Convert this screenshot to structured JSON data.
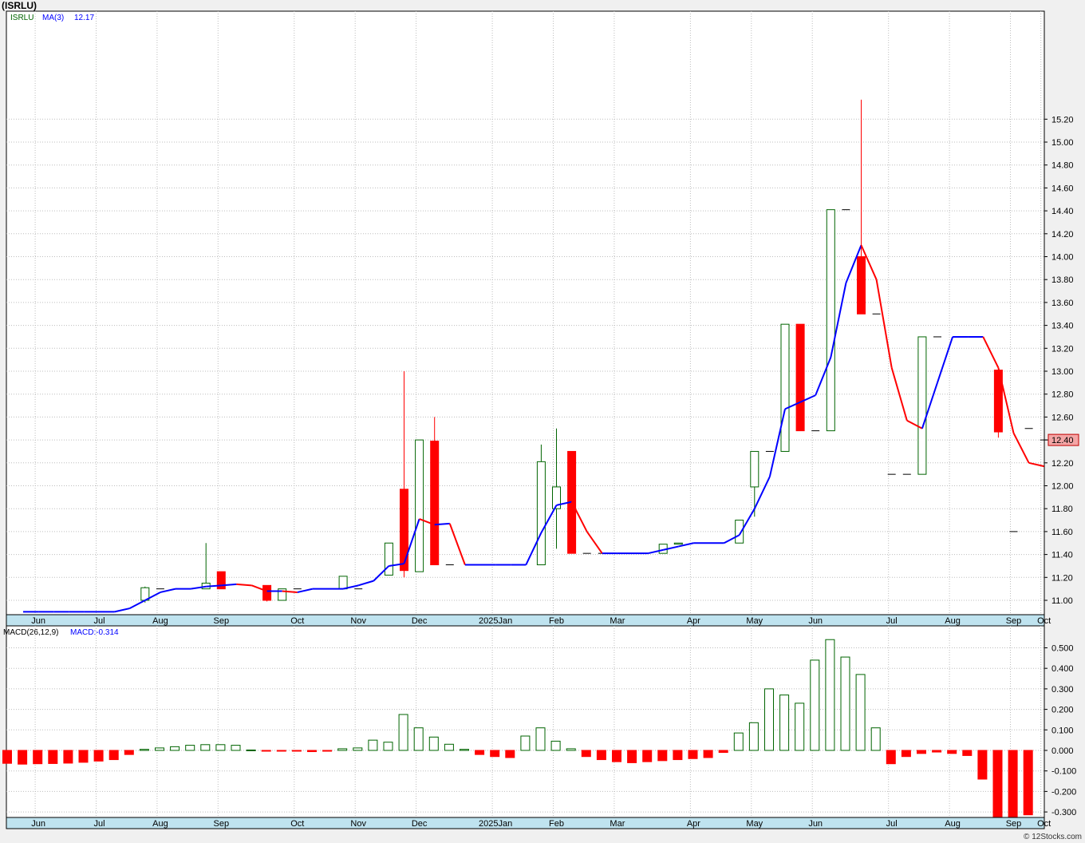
{
  "title": "(ISRLU)",
  "credit": "© 12Stocks.com",
  "colors": {
    "up": "#006400",
    "down": "#ff0000",
    "ma_up": "#0000ff",
    "ma_down": "#ff0000",
    "axis_bar": "#bfe3ef",
    "grid": "#bdbdbd"
  },
  "chart_data": [
    {
      "type": "candlestick",
      "legend": [
        {
          "text": "ISRLU",
          "color": "#006400"
        },
        {
          "text": "MA(3)",
          "color": "#0000ff"
        },
        {
          "text": "12.17",
          "color": "#0000ff"
        }
      ],
      "last_price": "12.40",
      "ylim": [
        10.87,
        15.49
      ],
      "yticks": [
        "11.00",
        "11.20",
        "11.40",
        "11.60",
        "11.80",
        "12.00",
        "12.20",
        "12.40",
        "12.60",
        "12.80",
        "13.00",
        "13.20",
        "13.40",
        "13.60",
        "13.80",
        "14.00",
        "14.20",
        "14.40",
        "14.60",
        "14.80",
        "15.00",
        "15.20"
      ],
      "xlabels": [
        "Jun",
        "Jul",
        "Aug",
        "Sep",
        "Oct",
        "Nov",
        "Dec",
        "2025Jan",
        "Feb",
        "Mar",
        "Apr",
        "May",
        "Jun",
        "Jul",
        "Aug",
        "Sep",
        "Oct"
      ],
      "xlabel_weeks": [
        1,
        5,
        9,
        13,
        18,
        22,
        26,
        31,
        35,
        39,
        44,
        48,
        52,
        57,
        61,
        65,
        67
      ],
      "weeks": 69,
      "candles": [
        {
          "w": 8,
          "o": 11.0,
          "h": 11.12,
          "l": 10.98,
          "c": 11.11
        },
        {
          "w": 9,
          "o": 11.1,
          "h": 11.1,
          "l": 11.1,
          "c": 11.1
        },
        {
          "w": 12,
          "o": 11.1,
          "h": 11.5,
          "l": 11.1,
          "c": 11.15
        },
        {
          "w": 13,
          "o": 11.25,
          "h": 11.25,
          "l": 11.1,
          "c": 11.1
        },
        {
          "w": 16,
          "o": 11.13,
          "h": 11.13,
          "l": 10.99,
          "c": 11.0
        },
        {
          "w": 17,
          "o": 11.0,
          "h": 11.1,
          "l": 11.0,
          "c": 11.1
        },
        {
          "w": 18,
          "o": 11.1,
          "h": 11.1,
          "l": 11.1,
          "c": 11.1
        },
        {
          "w": 21,
          "o": 11.1,
          "h": 11.21,
          "l": 11.1,
          "c": 11.21
        },
        {
          "w": 22,
          "o": 11.1,
          "h": 11.1,
          "l": 11.1,
          "c": 11.1
        },
        {
          "w": 24,
          "o": 11.22,
          "h": 11.5,
          "l": 11.22,
          "c": 11.5
        },
        {
          "w": 25,
          "o": 11.97,
          "h": 13.0,
          "l": 11.2,
          "c": 11.26
        },
        {
          "w": 26,
          "o": 11.25,
          "h": 12.4,
          "l": 11.25,
          "c": 12.4
        },
        {
          "w": 27,
          "o": 12.39,
          "h": 12.6,
          "l": 11.31,
          "c": 11.31
        },
        {
          "w": 28,
          "o": 11.31,
          "h": 11.31,
          "l": 11.31,
          "c": 11.31
        },
        {
          "w": 34,
          "o": 11.31,
          "h": 12.36,
          "l": 11.31,
          "c": 12.21
        },
        {
          "w": 35,
          "o": 11.8,
          "h": 12.5,
          "l": 11.45,
          "c": 11.99
        },
        {
          "w": 36,
          "o": 12.3,
          "h": 12.3,
          "l": 11.41,
          "c": 11.41
        },
        {
          "w": 37,
          "o": 11.41,
          "h": 11.41,
          "l": 11.41,
          "c": 11.41
        },
        {
          "w": 38,
          "o": 11.41,
          "h": 11.41,
          "l": 11.41,
          "c": 11.41
        },
        {
          "w": 42,
          "o": 11.41,
          "h": 11.49,
          "l": 11.41,
          "c": 11.49
        },
        {
          "w": 43,
          "o": 11.49,
          "h": 11.5,
          "l": 11.49,
          "c": 11.5
        },
        {
          "w": 47,
          "o": 11.5,
          "h": 11.7,
          "l": 11.5,
          "c": 11.7
        },
        {
          "w": 48,
          "o": 11.99,
          "h": 12.3,
          "l": 11.73,
          "c": 12.3
        },
        {
          "w": 49,
          "o": 12.3,
          "h": 12.3,
          "l": 12.3,
          "c": 12.3
        },
        {
          "w": 50,
          "o": 12.3,
          "h": 13.41,
          "l": 12.3,
          "c": 13.41
        },
        {
          "w": 51,
          "o": 13.41,
          "h": 13.41,
          "l": 12.48,
          "c": 12.48
        },
        {
          "w": 52,
          "o": 12.48,
          "h": 12.48,
          "l": 12.48,
          "c": 12.48
        },
        {
          "w": 53,
          "o": 12.48,
          "h": 14.41,
          "l": 12.48,
          "c": 14.41
        },
        {
          "w": 54,
          "o": 14.41,
          "h": 14.41,
          "l": 14.41,
          "c": 14.41
        },
        {
          "w": 55,
          "o": 14.0,
          "h": 15.37,
          "l": 13.5,
          "c": 13.5
        },
        {
          "w": 56,
          "o": 13.5,
          "h": 13.5,
          "l": 13.5,
          "c": 13.5
        },
        {
          "w": 57,
          "o": 12.1,
          "h": 12.1,
          "l": 12.1,
          "c": 12.1
        },
        {
          "w": 58,
          "o": 12.1,
          "h": 12.1,
          "l": 12.1,
          "c": 12.1
        },
        {
          "w": 59,
          "o": 12.1,
          "h": 13.3,
          "l": 12.1,
          "c": 13.3
        },
        {
          "w": 60,
          "o": 13.3,
          "h": 13.3,
          "l": 13.3,
          "c": 13.3
        },
        {
          "w": 62,
          "o": 13.3,
          "h": 13.3,
          "l": 13.3,
          "c": 13.3
        },
        {
          "w": 64,
          "o": 13.01,
          "h": 13.01,
          "l": 12.42,
          "c": 12.47
        },
        {
          "w": 65,
          "o": 11.6,
          "h": 11.6,
          "l": 11.6,
          "c": 11.6
        },
        {
          "w": 66,
          "o": 12.5,
          "h": 12.5,
          "l": 12.5,
          "c": 12.5
        },
        {
          "w": 67,
          "o": 12.4,
          "h": 12.4,
          "l": 12.4,
          "c": 12.4
        }
      ],
      "ma": [
        {
          "w": 0,
          "v": 10.9
        },
        {
          "w": 1,
          "v": 10.9
        },
        {
          "w": 2,
          "v": 10.9
        },
        {
          "w": 3,
          "v": 10.9
        },
        {
          "w": 4,
          "v": 10.9
        },
        {
          "w": 5,
          "v": 10.9
        },
        {
          "w": 6,
          "v": 10.9
        },
        {
          "w": 7,
          "v": 10.93
        },
        {
          "w": 8,
          "v": 11.0
        },
        {
          "w": 9,
          "v": 11.07
        },
        {
          "w": 10,
          "v": 11.1
        },
        {
          "w": 11,
          "v": 11.1
        },
        {
          "w": 12,
          "v": 11.12
        },
        {
          "w": 13,
          "v": 11.13
        },
        {
          "w": 14,
          "v": 11.14
        },
        {
          "w": 15,
          "v": 11.13
        },
        {
          "w": 16,
          "v": 11.08
        },
        {
          "w": 17,
          "v": 11.08
        },
        {
          "w": 18,
          "v": 11.07
        },
        {
          "w": 19,
          "v": 11.1
        },
        {
          "w": 20,
          "v": 11.1
        },
        {
          "w": 21,
          "v": 11.1
        },
        {
          "w": 22,
          "v": 11.13
        },
        {
          "w": 23,
          "v": 11.17
        },
        {
          "w": 24,
          "v": 11.3
        },
        {
          "w": 25,
          "v": 11.32
        },
        {
          "w": 26,
          "v": 11.71
        },
        {
          "w": 27,
          "v": 11.66
        },
        {
          "w": 28,
          "v": 11.67
        },
        {
          "w": 29,
          "v": 11.31
        },
        {
          "w": 30,
          "v": 11.31
        },
        {
          "w": 31,
          "v": 11.31
        },
        {
          "w": 32,
          "v": 11.31
        },
        {
          "w": 33,
          "v": 11.31
        },
        {
          "w": 34,
          "v": 11.59
        },
        {
          "w": 35,
          "v": 11.83
        },
        {
          "w": 36,
          "v": 11.86
        },
        {
          "w": 37,
          "v": 11.6
        },
        {
          "w": 38,
          "v": 11.41
        },
        {
          "w": 39,
          "v": 11.41
        },
        {
          "w": 40,
          "v": 11.41
        },
        {
          "w": 41,
          "v": 11.41
        },
        {
          "w": 42,
          "v": 11.44
        },
        {
          "w": 43,
          "v": 11.47
        },
        {
          "w": 44,
          "v": 11.5
        },
        {
          "w": 45,
          "v": 11.5
        },
        {
          "w": 46,
          "v": 11.5
        },
        {
          "w": 47,
          "v": 11.57
        },
        {
          "w": 48,
          "v": 11.8
        },
        {
          "w": 49,
          "v": 12.08
        },
        {
          "w": 50,
          "v": 12.67
        },
        {
          "w": 51,
          "v": 12.73
        },
        {
          "w": 52,
          "v": 12.79
        },
        {
          "w": 53,
          "v": 13.12
        },
        {
          "w": 54,
          "v": 13.77
        },
        {
          "w": 55,
          "v": 14.1
        },
        {
          "w": 56,
          "v": 13.8
        },
        {
          "w": 57,
          "v": 13.03
        },
        {
          "w": 58,
          "v": 12.57
        },
        {
          "w": 59,
          "v": 12.5
        },
        {
          "w": 60,
          "v": 12.9
        },
        {
          "w": 61,
          "v": 13.3
        },
        {
          "w": 62,
          "v": 13.3
        },
        {
          "w": 63,
          "v": 13.3
        },
        {
          "w": 64,
          "v": 13.03
        },
        {
          "w": 65,
          "v": 12.46
        },
        {
          "w": 66,
          "v": 12.2
        },
        {
          "w": 67,
          "v": 12.17
        }
      ]
    },
    {
      "type": "bar",
      "legend": [
        {
          "text": "MACD(26,12,9)",
          "color": "#000000"
        },
        {
          "text": "MACD:-0.314",
          "color": "#0000ff"
        }
      ],
      "ylim": [
        -0.325,
        0.555
      ],
      "yticks": [
        "-0.300",
        "-0.200",
        "-0.100",
        "0.000",
        "0.100",
        "0.200",
        "0.300",
        "0.400",
        "0.500"
      ],
      "xlabels": [
        "Jun",
        "Jul",
        "Aug",
        "Sep",
        "Oct",
        "Nov",
        "Dec",
        "2025Jan",
        "Feb",
        "Mar",
        "Apr",
        "May",
        "Jun",
        "Jul",
        "Aug",
        "Sep",
        "Oct"
      ],
      "values": [
        -0.063,
        -0.067,
        -0.065,
        -0.064,
        -0.062,
        -0.058,
        -0.052,
        -0.045,
        -0.02,
        0.005,
        0.012,
        0.018,
        0.025,
        0.028,
        0.028,
        0.025,
        0.002,
        -0.003,
        -0.002,
        -0.002,
        -0.006,
        -0.004,
        0.008,
        0.012,
        0.05,
        0.04,
        0.175,
        0.11,
        0.065,
        0.03,
        0.005,
        -0.02,
        -0.03,
        -0.035,
        0.07,
        0.11,
        0.045,
        0.008,
        -0.03,
        -0.045,
        -0.055,
        -0.06,
        -0.055,
        -0.05,
        -0.045,
        -0.04,
        -0.035,
        -0.01,
        0.085,
        0.135,
        0.3,
        0.27,
        0.23,
        0.44,
        0.54,
        0.455,
        0.37,
        0.11,
        -0.065,
        -0.03,
        -0.015,
        -0.008,
        -0.015,
        -0.025,
        -0.14,
        -0.335,
        -0.325,
        -0.314
      ]
    }
  ]
}
